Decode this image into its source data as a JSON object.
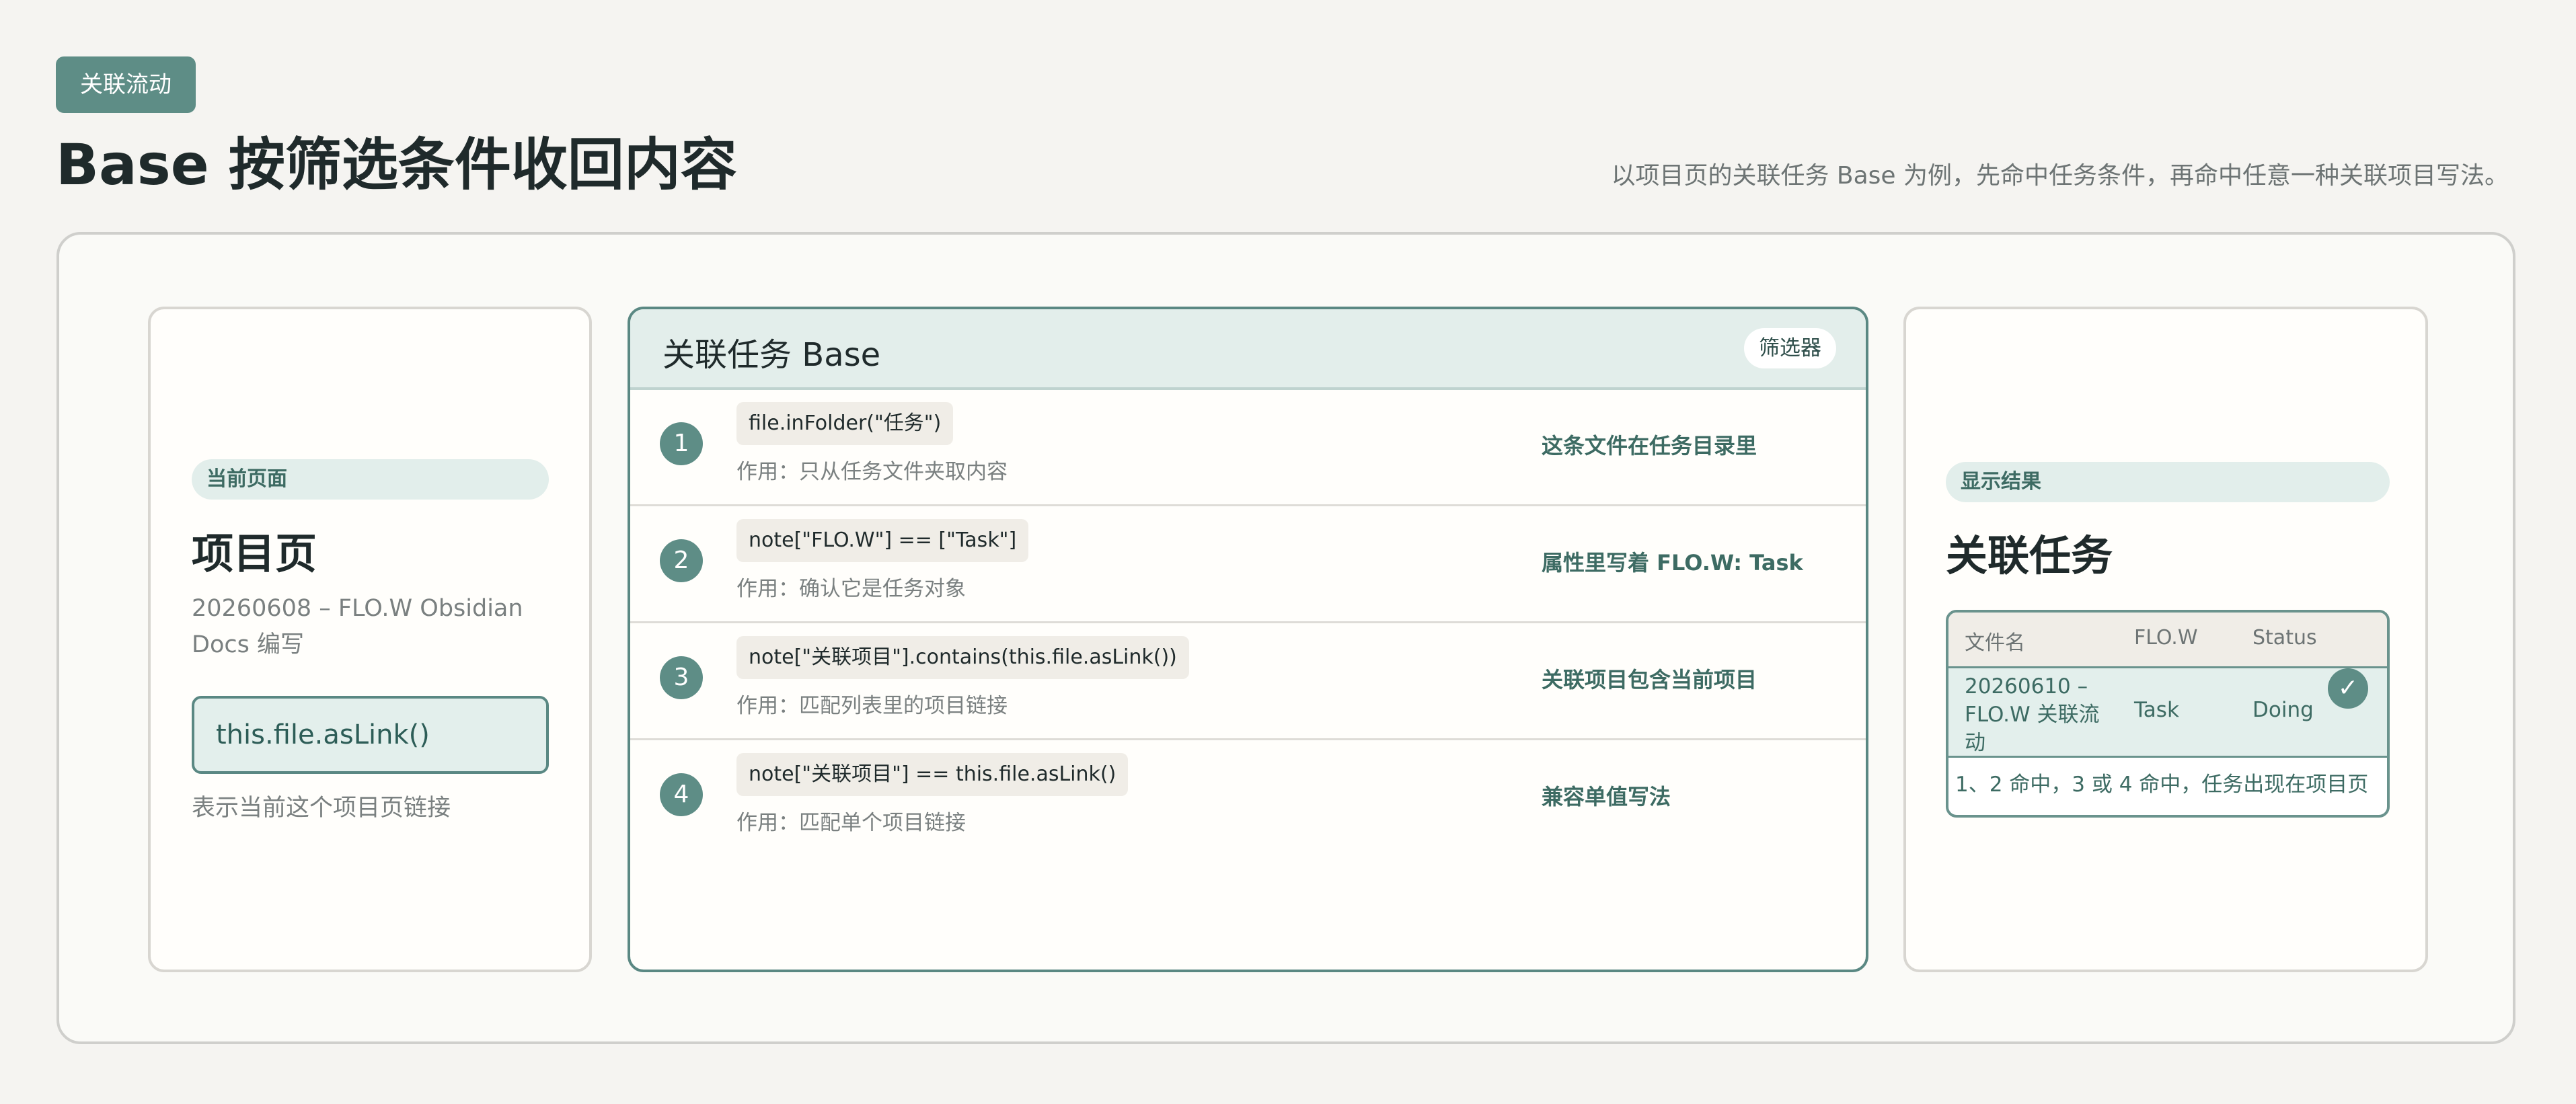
{
  "header": {
    "tag": "关联流动",
    "title": "Base 按筛选条件收回内容",
    "subtitle": "以项目页的关联任务 Base 为例，先命中任务条件，再命中任意一种关联项目写法。"
  },
  "left": {
    "pill": "当前页面",
    "title": "项目页",
    "meta": "20260608 – FLO.W Obsidian Docs 编写",
    "code": "this.file.asLink()",
    "note": "表示当前这个项目页链接"
  },
  "middle": {
    "title": "关联任务 Base",
    "filter_label": "筛选器",
    "rows": [
      {
        "num": "1",
        "code": "file.inFolder(\"任务\")",
        "role": "作用：只从任务文件夹取内容",
        "desc": "这条文件在任务目录里"
      },
      {
        "num": "2",
        "code": "note[\"FLO.W\"] == [\"Task\"]",
        "role": "作用：确认它是任务对象",
        "desc": "属性里写着 FLO.W: Task"
      },
      {
        "num": "3",
        "code": "note[\"关联项目\"].contains(this.file.asLink())",
        "role": "作用：匹配列表里的项目链接",
        "desc": "关联项目包含当前项目"
      },
      {
        "num": "4",
        "code": "note[\"关联项目\"] == this.file.asLink()",
        "role": "作用：匹配单个项目链接",
        "desc": "兼容单值写法"
      }
    ]
  },
  "right": {
    "pill": "显示结果",
    "title": "关联任务",
    "table": {
      "headers": [
        "文件名",
        "FLO.W",
        "Status"
      ],
      "row": {
        "name": "20260610 – FLO.W 关联流动",
        "flow": "Task",
        "status": "Doing"
      },
      "footer": "1、2 命中，3 或 4 命中，任务出现在项目页"
    }
  }
}
